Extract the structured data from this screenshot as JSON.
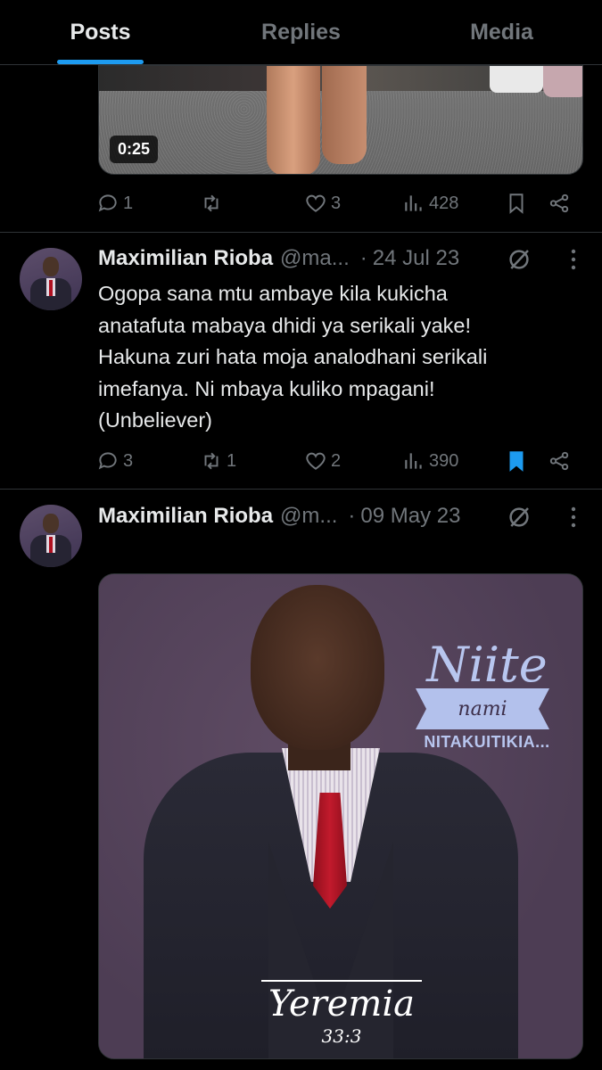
{
  "tabs": [
    {
      "label": "Posts",
      "active": true
    },
    {
      "label": "Replies",
      "active": false
    },
    {
      "label": "Media",
      "active": false
    }
  ],
  "post0": {
    "video_duration": "0:25",
    "actions": {
      "replies": "1",
      "reposts": "",
      "likes": "3",
      "views": "428",
      "bookmarked": false
    }
  },
  "post1": {
    "author": "Maximilian Rioba",
    "handle": "@ma...",
    "date": "24 Jul 23",
    "text": "Ogopa sana mtu ambaye kila kukicha\nanatafuta mabaya dhidi ya serikali yake!\nHakuna zuri hata moja analodhani serikali\nimefanya. Ni mbaya kuliko mpagani!\n(Unbeliever)",
    "actions": {
      "replies": "3",
      "reposts": "1",
      "likes": "2",
      "views": "390",
      "bookmarked": true
    }
  },
  "post2": {
    "author": "Maximilian Rioba",
    "handle": "@m...",
    "date": "09 May 23",
    "poster": {
      "title_big": "Niite",
      "title_ribbon": "nami",
      "title_small": "NITAKUITIKIA...",
      "verse_book": "Yeremia",
      "verse_ref": "33:3"
    }
  },
  "colors": {
    "accent": "#1d9bf0",
    "muted": "#71767b",
    "text": "#e7e9ea",
    "divider": "#2f3336",
    "bookmark_active": "#1d9bf0"
  }
}
